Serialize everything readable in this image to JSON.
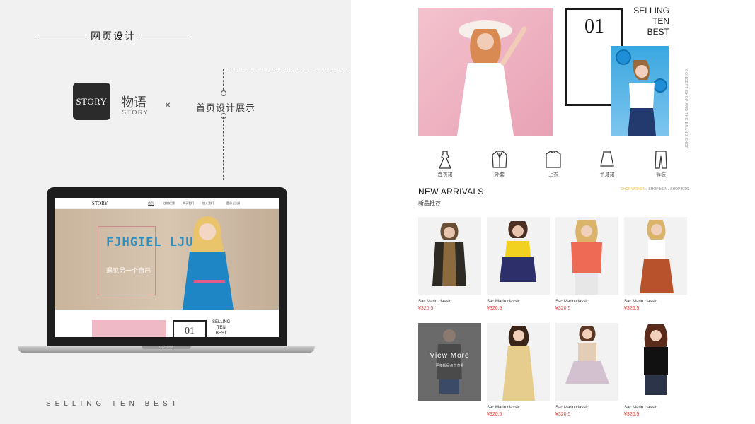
{
  "left": {
    "page_title": "网页设计",
    "logo_text": "STORY",
    "brand_cn": "物语",
    "brand_en": "STORY",
    "times": "×",
    "sub_title": "首页设计展示",
    "bottom_text": "SELLING TEN BEST",
    "laptop_label": "MacBook",
    "screen": {
      "logo": "STORY",
      "nav": [
        "首页",
        "店铺优惠",
        "关于我们",
        "加入我们",
        "登录 | 注册"
      ],
      "hero_text": "FJHGIEL LJU",
      "hero_cn": "遇见另一个自己",
      "box_num": "01",
      "sell_lines": [
        "SELLING",
        "TEN",
        "BEST"
      ]
    }
  },
  "right": {
    "box_num": "01",
    "sell_lines": [
      "SELLING",
      "TEN",
      "BEST"
    ],
    "vertical_text": "CONCEPT SHOP AND THE BRAND SHOP",
    "categories": [
      {
        "label": "连衣裙",
        "icon": "dress-icon"
      },
      {
        "label": "外套",
        "icon": "coat-icon"
      },
      {
        "label": "上衣",
        "icon": "shirt-icon"
      },
      {
        "label": "半身裙",
        "icon": "skirt-icon"
      },
      {
        "label": "裤装",
        "icon": "pants-icon"
      }
    ],
    "arrivals_title": "NEW ARRIVALS",
    "arrivals_cn": "新品推荐",
    "shop_links": {
      "active": "SHOP WOMEN",
      "sep": " / ",
      "men": "SHOP MEN",
      "kids": "SHOP KIDS"
    },
    "view_more": {
      "title": "View More",
      "sub": "更多新品点击查看"
    },
    "products": [
      {
        "name": "Sac Marin classic",
        "price": "¥320.5"
      },
      {
        "name": "Sac Marin classic",
        "price": "¥320.5"
      },
      {
        "name": "Sac Marin classic",
        "price": "¥320.5"
      },
      {
        "name": "Sac Marin classic",
        "price": "¥320.5"
      },
      {
        "name": "Sac Marin classic",
        "price": "¥320.5"
      },
      {
        "name": "Sac Marin classic",
        "price": "¥320.5"
      },
      {
        "name": "Sac Marin classic",
        "price": "¥320.5"
      }
    ]
  },
  "colors": {
    "price": "#e0463c",
    "accent": "#f2b33a",
    "hero_pink": "#f0b9c6",
    "hero_blue": "#2a8fc2"
  }
}
